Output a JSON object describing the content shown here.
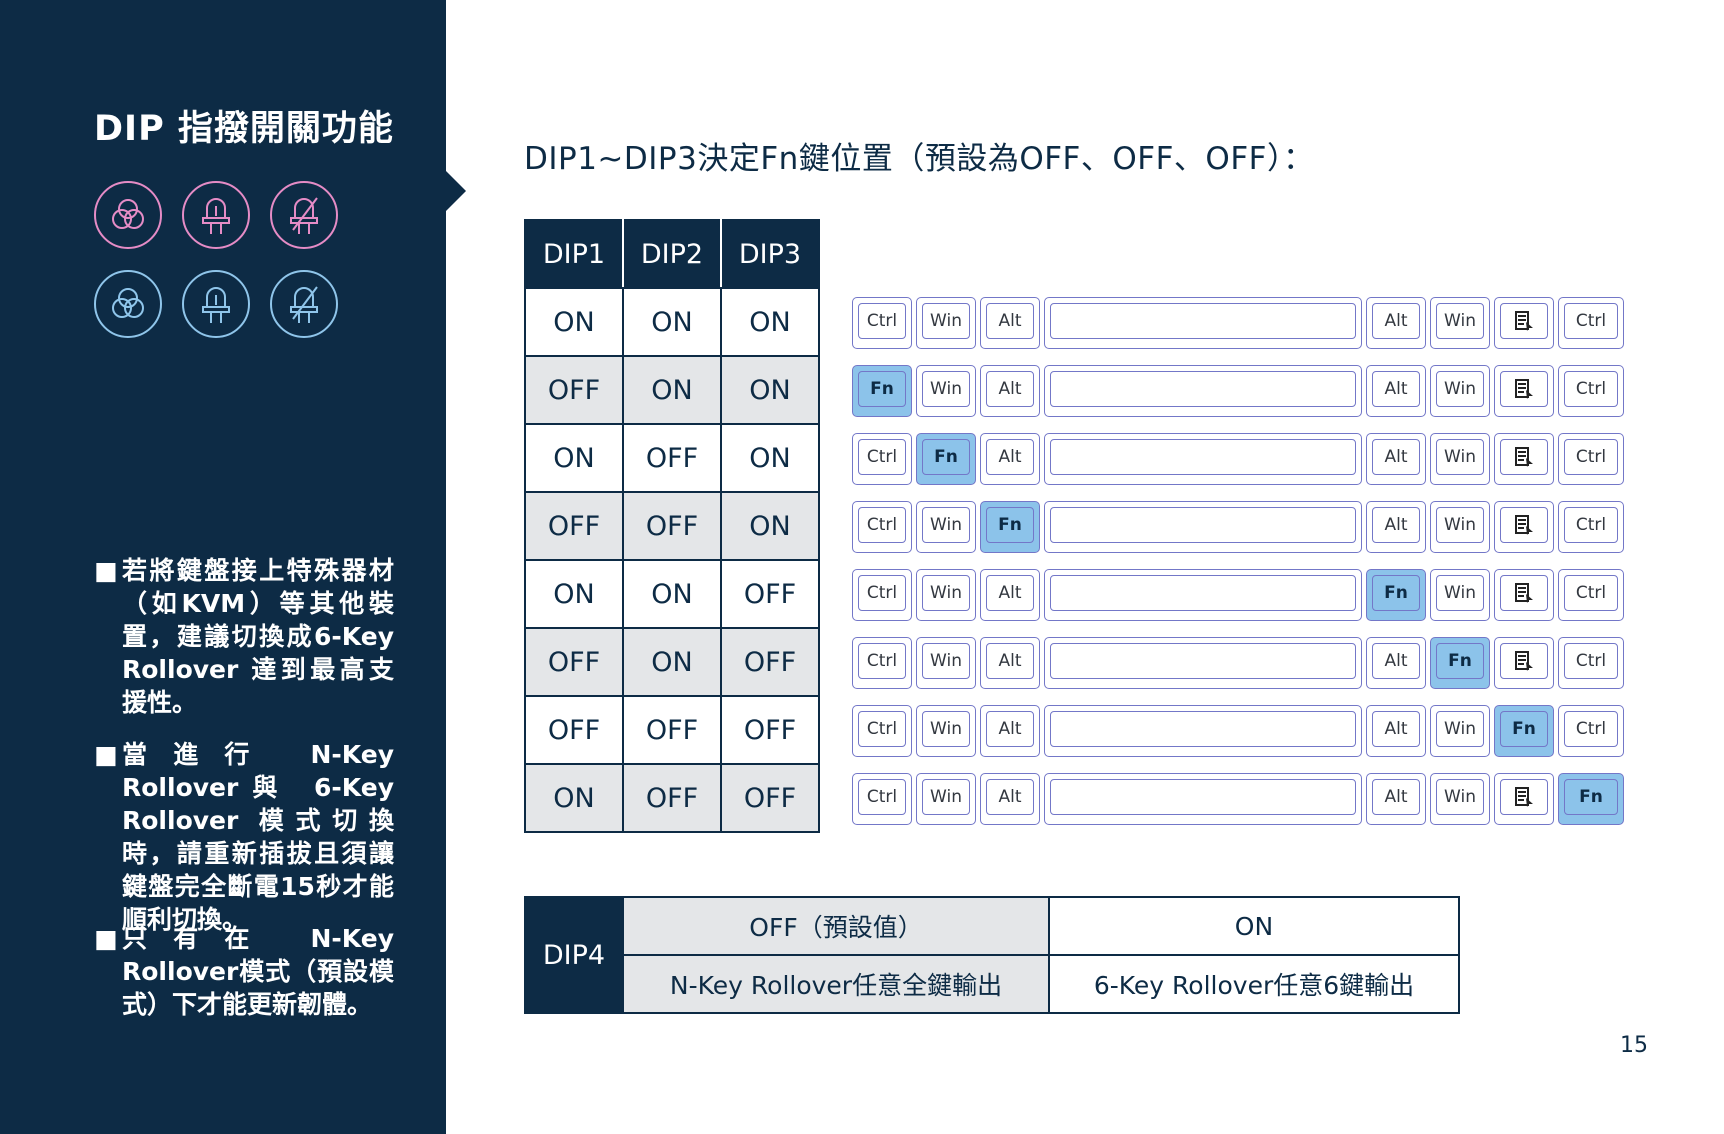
{
  "sidebar": {
    "title": "DIP 指撥開關功能",
    "notes": [
      {
        "bullet": "■",
        "text": "若將鍵盤接上特殊器材（如KVM）等其他裝置，建議切換成6-Key Rollover 達到最高支援性。"
      },
      {
        "bullet": "■",
        "text": "當進行 N-Key Rollover與 6-Key Rollover 模式切換時，請重新插拔且須讓鍵盤完全斷電15秒才能順利切換。"
      },
      {
        "bullet": "■",
        "text": "只有在 N-Key Rollover模式（預設模式）下才能更新韌體。"
      }
    ],
    "icons": [
      {
        "name": "rgb-color-icon",
        "color": "#e58cc6"
      },
      {
        "name": "led-icon",
        "color": "#e58cc6"
      },
      {
        "name": "led-off-icon",
        "color": "#e58cc6"
      },
      {
        "name": "rgb-color-icon",
        "color": "#8fc5ea"
      },
      {
        "name": "led-icon",
        "color": "#8fc5ea"
      },
      {
        "name": "led-off-icon",
        "color": "#8fc5ea"
      }
    ]
  },
  "heading": "DIP1~DIP3決定Fn鍵位置（預設為OFF、OFF、OFF）：",
  "dip_table": {
    "headers": [
      "DIP1",
      "DIP2",
      "DIP3"
    ],
    "rows": [
      [
        "ON",
        "ON",
        "ON"
      ],
      [
        "OFF",
        "ON",
        "ON"
      ],
      [
        "ON",
        "OFF",
        "ON"
      ],
      [
        "OFF",
        "OFF",
        "ON"
      ],
      [
        "ON",
        "ON",
        "OFF"
      ],
      [
        "OFF",
        "ON",
        "OFF"
      ],
      [
        "OFF",
        "OFF",
        "OFF"
      ],
      [
        "ON",
        "OFF",
        "OFF"
      ]
    ]
  },
  "keyboard_rows": [
    [
      "Ctrl",
      "Win",
      "Alt",
      "",
      "Alt",
      "Win",
      "menu",
      "Ctrl"
    ],
    [
      "Fn",
      "Win",
      "Alt",
      "",
      "Alt",
      "Win",
      "menu",
      "Ctrl"
    ],
    [
      "Ctrl",
      "Fn",
      "Alt",
      "",
      "Alt",
      "Win",
      "menu",
      "Ctrl"
    ],
    [
      "Ctrl",
      "Win",
      "Fn",
      "",
      "Alt",
      "Win",
      "menu",
      "Ctrl"
    ],
    [
      "Ctrl",
      "Win",
      "Alt",
      "",
      "Fn",
      "Win",
      "menu",
      "Ctrl"
    ],
    [
      "Ctrl",
      "Win",
      "Alt",
      "",
      "Alt",
      "Fn",
      "menu",
      "Ctrl"
    ],
    [
      "Ctrl",
      "Win",
      "Alt",
      "",
      "Alt",
      "Win",
      "Fn",
      "Ctrl"
    ],
    [
      "Ctrl",
      "Win",
      "Alt",
      "",
      "Alt",
      "Win",
      "menu",
      "Fn"
    ]
  ],
  "fn_highlight_color": "#8cc3ea",
  "dip4": {
    "label": "DIP4",
    "off_header": "OFF（預設值）",
    "on_header": "ON",
    "off_desc": "N-Key Rollover任意全鍵輸出",
    "on_desc": "6-Key Rollover任意6鍵輸出"
  },
  "page_number": "15"
}
